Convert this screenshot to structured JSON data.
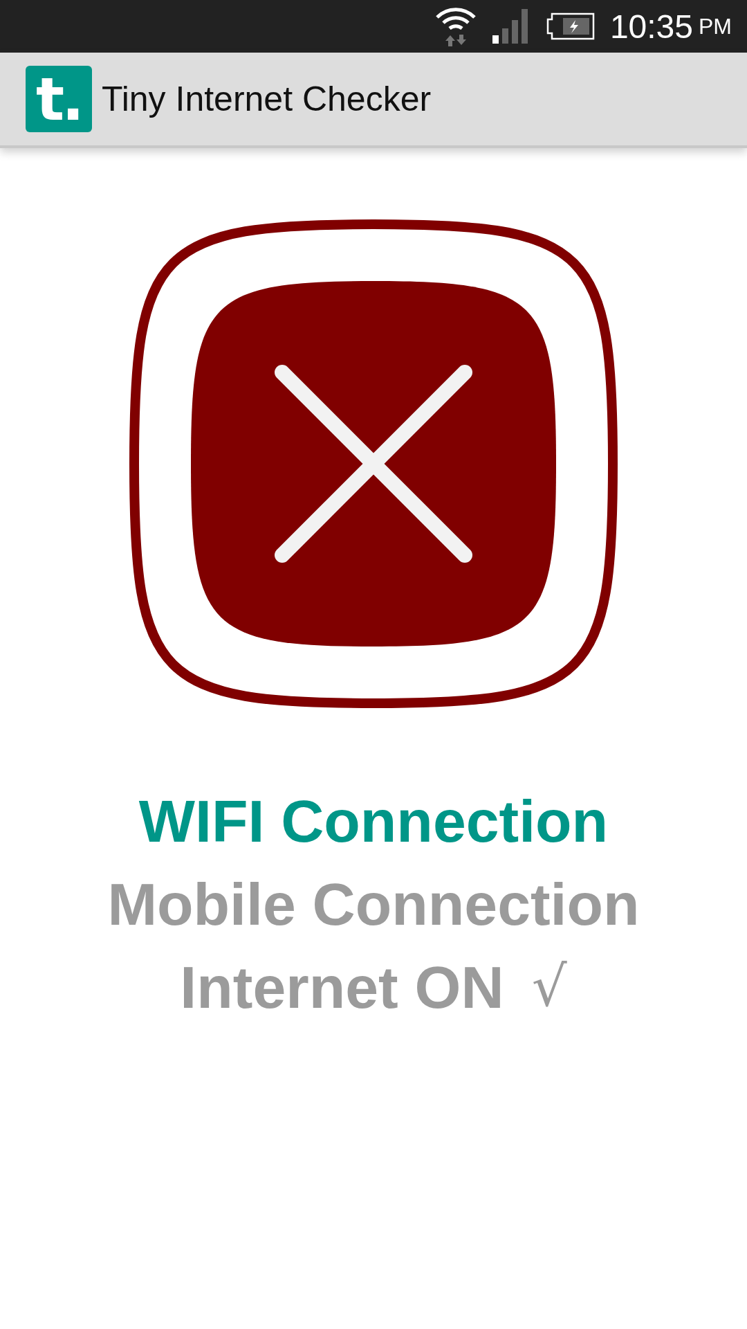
{
  "status_bar": {
    "time": "10:35",
    "ampm": "PM"
  },
  "app_bar": {
    "logo": "t.",
    "title": "Tiny Internet Checker"
  },
  "result": {
    "kind": "fail"
  },
  "connections": [
    {
      "label": "WIFI Connection",
      "on": true
    },
    {
      "label": "Mobile Connection",
      "on": false
    }
  ],
  "internet": {
    "label": "Internet ON",
    "mark": "√"
  }
}
